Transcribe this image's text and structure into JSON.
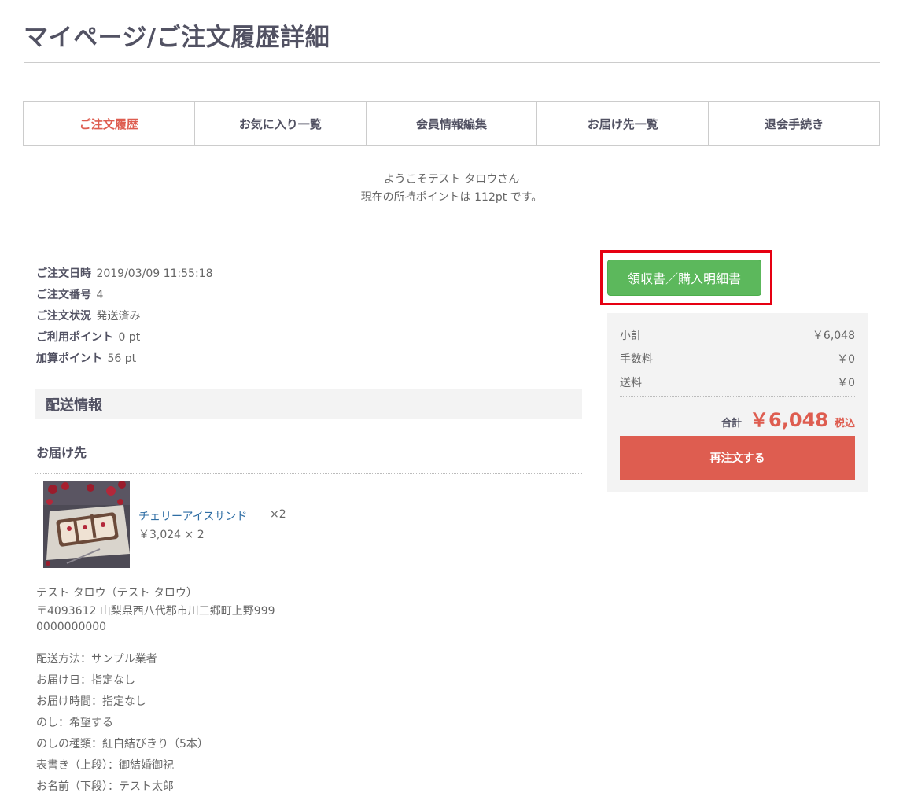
{
  "page": {
    "title": "マイページ/ご注文履歴詳細"
  },
  "tabs": [
    {
      "label": "ご注文履歴",
      "active": true
    },
    {
      "label": "お気に入り一覧"
    },
    {
      "label": "会員情報編集"
    },
    {
      "label": "お届け先一覧"
    },
    {
      "label": "退会手続き"
    }
  ],
  "welcome": {
    "line1": "ようこそテスト タロウさん",
    "line2": "現在の所持ポイントは 112pt です。"
  },
  "order": {
    "date_label": "ご注文日時",
    "date_value": "2019/03/09 11:55:18",
    "number_label": "ご注文番号",
    "number_value": "4",
    "status_label": "ご注文状況",
    "status_value": "発送済み",
    "used_points_label": "ご利用ポイント",
    "used_points_value": "0 pt",
    "added_points_label": "加算ポイント",
    "added_points_value": "56 pt"
  },
  "shipping": {
    "section_title": "配送情報",
    "subheading": "お届け先",
    "product": {
      "name": "チェリーアイスサンド",
      "qty": "×2",
      "price": "￥3,024 × 2"
    },
    "name": "テスト タロウ（テスト タロウ）",
    "address": "〒4093612 山梨県西八代郡市川三郷町上野999",
    "phone": "0000000000",
    "details": [
      "配送方法：サンプル業者",
      "お届け日：指定なし",
      "お届け時間：指定なし",
      "のし：希望する",
      "のしの種類：紅白結びきり（5本）",
      "表書き（上段）：御結婚御祝",
      "お名前（下段）：テスト太郎"
    ]
  },
  "summary": {
    "receipt_button": "領収書／購入明細書",
    "subtotal_label": "小計",
    "subtotal_value": "￥6,048",
    "fee_label": "手数料",
    "fee_value": "￥0",
    "postage_label": "送料",
    "postage_value": "￥0",
    "total_label": "合計",
    "total_value": "￥6,048",
    "tax_label": "税込",
    "reorder_button": "再注文する"
  },
  "colors": {
    "accent": "#de5d50",
    "link": "#2e6da4",
    "receipt_button": "#5cb85c",
    "highlight": "#e60012"
  }
}
